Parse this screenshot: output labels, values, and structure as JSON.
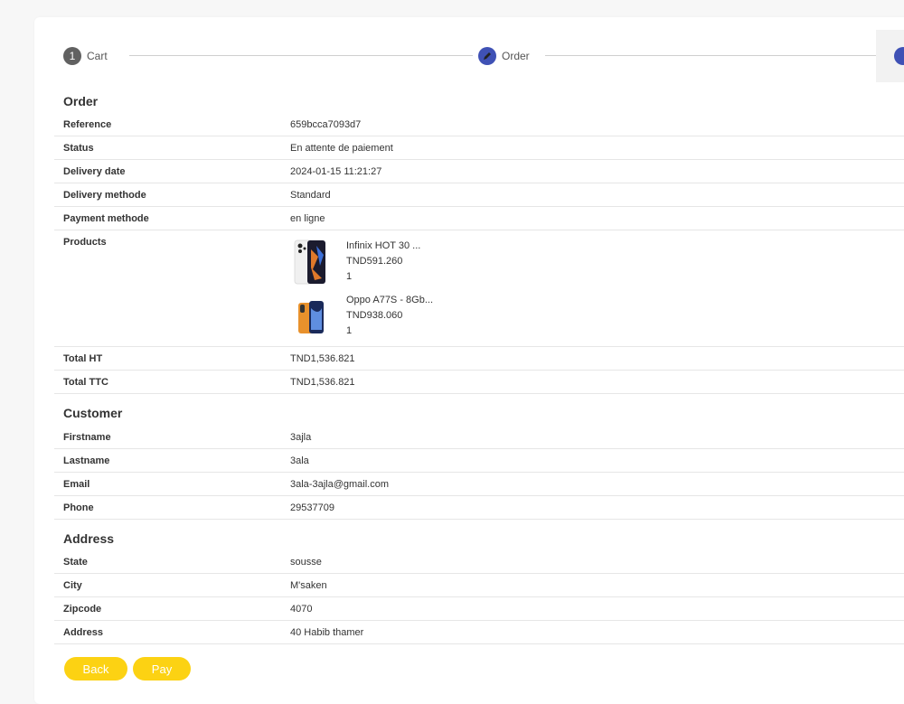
{
  "stepper": {
    "steps": [
      {
        "number": "1",
        "label": "Cart"
      },
      {
        "label": "Order"
      }
    ]
  },
  "order": {
    "title": "Order",
    "rows": [
      {
        "label": "Reference",
        "value": "659bcca7093d7"
      },
      {
        "label": "Status",
        "value": "En attente de paiement"
      },
      {
        "label": "Delivery date",
        "value": "2024-01-15 11:21:27"
      },
      {
        "label": "Delivery methode",
        "value": "Standard"
      },
      {
        "label": "Payment methode",
        "value": "en ligne"
      }
    ],
    "products_label": "Products",
    "products": [
      {
        "name": "Infinix HOT 30 ...",
        "price": "TND591.260",
        "qty": "1"
      },
      {
        "name": "Oppo A77S - 8Gb...",
        "price": "TND938.060",
        "qty": "1"
      }
    ],
    "totals": [
      {
        "label": "Total HT",
        "value": "TND1,536.821"
      },
      {
        "label": "Total TTC",
        "value": "TND1,536.821"
      }
    ]
  },
  "customer": {
    "title": "Customer",
    "rows": [
      {
        "label": "Firstname",
        "value": "3ajla"
      },
      {
        "label": "Lastname",
        "value": "3ala"
      },
      {
        "label": "Email",
        "value": "3ala-3ajla@gmail.com"
      },
      {
        "label": "Phone",
        "value": "29537709"
      }
    ]
  },
  "address": {
    "title": "Address",
    "rows": [
      {
        "label": "State",
        "value": "sousse"
      },
      {
        "label": "City",
        "value": "M'saken"
      },
      {
        "label": "Zipcode",
        "value": "4070"
      },
      {
        "label": "Address",
        "value": "40 Habib thamer"
      }
    ]
  },
  "buttons": {
    "back": "Back",
    "pay": "Pay"
  },
  "colors": {
    "accent": "#fcd213",
    "step_active": "#3f51b5",
    "step_done": "#616161"
  }
}
